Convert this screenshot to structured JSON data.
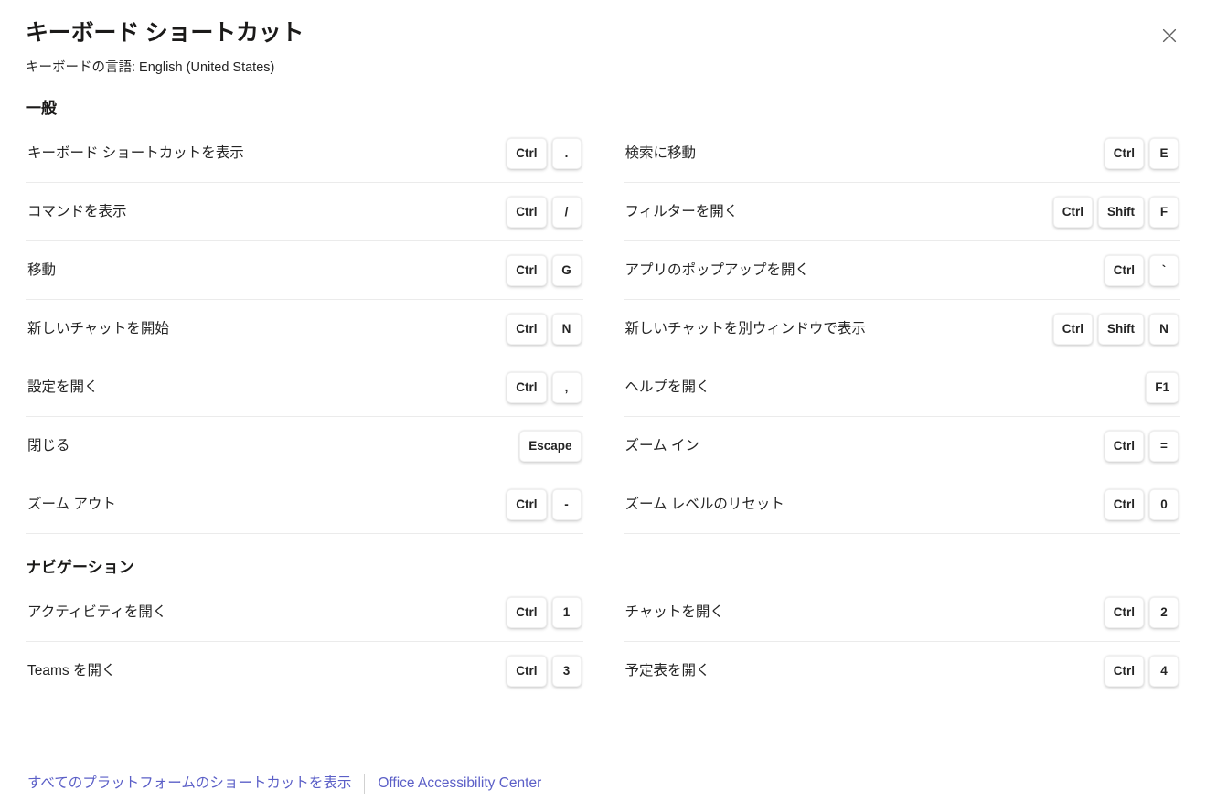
{
  "dialog": {
    "title": "キーボード ショートカット",
    "subtitle": "キーボードの言語: English (United States)",
    "close_label": "×"
  },
  "colors": {
    "link": "#5b5fc7",
    "text": "#242424",
    "divider": "#ebebeb",
    "key_bg": "#ffffff"
  },
  "sections": [
    {
      "title": "一般",
      "left": [
        {
          "label": "キーボード ショートカットを表示",
          "keys": [
            "Ctrl",
            "."
          ]
        },
        {
          "label": "コマンドを表示",
          "keys": [
            "Ctrl",
            "/"
          ]
        },
        {
          "label": "移動",
          "keys": [
            "Ctrl",
            "G"
          ]
        },
        {
          "label": "新しいチャットを開始",
          "keys": [
            "Ctrl",
            "N"
          ]
        },
        {
          "label": "設定を開く",
          "keys": [
            "Ctrl",
            ","
          ]
        },
        {
          "label": "閉じる",
          "keys": [
            "Escape"
          ]
        },
        {
          "label": "ズーム アウト",
          "keys": [
            "Ctrl",
            "-"
          ]
        }
      ],
      "right": [
        {
          "label": "検索に移動",
          "keys": [
            "Ctrl",
            "E"
          ]
        },
        {
          "label": "フィルターを開く",
          "keys": [
            "Ctrl",
            "Shift",
            "F"
          ]
        },
        {
          "label": "アプリのポップアップを開く",
          "keys": [
            "Ctrl",
            "`"
          ]
        },
        {
          "label": "新しいチャットを別ウィンドウで表示",
          "keys": [
            "Ctrl",
            "Shift",
            "N"
          ]
        },
        {
          "label": "ヘルプを開く",
          "keys": [
            "F1"
          ]
        },
        {
          "label": "ズーム イン",
          "keys": [
            "Ctrl",
            "="
          ]
        },
        {
          "label": "ズーム レベルのリセット",
          "keys": [
            "Ctrl",
            "0"
          ]
        }
      ]
    },
    {
      "title": "ナビゲーション",
      "left": [
        {
          "label": "アクティビティを開く",
          "keys": [
            "Ctrl",
            "1"
          ]
        },
        {
          "label": "Teams を開く",
          "keys": [
            "Ctrl",
            "3"
          ]
        }
      ],
      "right": [
        {
          "label": "チャットを開く",
          "keys": [
            "Ctrl",
            "2"
          ]
        },
        {
          "label": "予定表を開く",
          "keys": [
            "Ctrl",
            "4"
          ]
        }
      ]
    }
  ],
  "footer": {
    "links": [
      "すべてのプラットフォームのショートカットを表示",
      "Office Accessibility Center"
    ]
  }
}
